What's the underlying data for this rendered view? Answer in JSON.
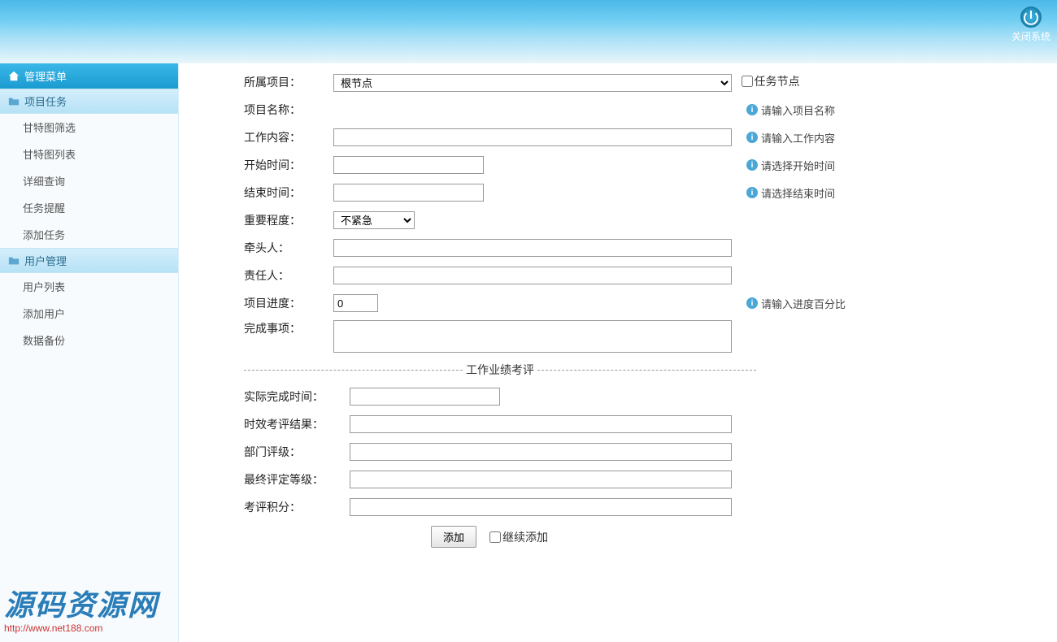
{
  "header": {
    "close_system_label": "关闭系统"
  },
  "sidebar": {
    "menu_title": "管理菜单",
    "groups": [
      {
        "name": "project_tasks",
        "label": "项目任务",
        "items": [
          {
            "name": "gantt_filter",
            "label": "甘特图筛选"
          },
          {
            "name": "gantt_list",
            "label": "甘特图列表"
          },
          {
            "name": "detail_query",
            "label": "详细查询"
          },
          {
            "name": "task_reminder",
            "label": "任务提醒"
          },
          {
            "name": "add_task",
            "label": "添加任务"
          }
        ]
      },
      {
        "name": "user_mgmt",
        "label": "用户管理",
        "items": [
          {
            "name": "user_list",
            "label": "用户列表"
          },
          {
            "name": "add_user",
            "label": "添加用户"
          },
          {
            "name": "data_backup",
            "label": "数据备份"
          }
        ]
      }
    ]
  },
  "form": {
    "project_label": "所属项目：",
    "project_value": "根节点",
    "task_node_label": "任务节点",
    "name_label": "项目名称：",
    "name_hint": "请输入项目名称",
    "content_label": "工作内容：",
    "content_hint": "请输入工作内容",
    "start_label": "开始时间：",
    "start_hint": "请选择开始时间",
    "end_label": "结束时间：",
    "end_hint": "请选择结束时间",
    "priority_label": "重要程度：",
    "priority_value": "不紧急",
    "leader_label": "牵头人：",
    "owner_label": "责任人：",
    "progress_label": "项目进度：",
    "progress_value": "0",
    "progress_hint": "请输入进度百分比",
    "done_items_label": "完成事项：",
    "section_title": "工作业绩考评",
    "actual_done_label": "实际完成时间：",
    "eff_result_label": "时效考评结果：",
    "dept_grade_label": "部门评级：",
    "final_grade_label": "最终评定等级：",
    "score_label": "考评积分：",
    "add_button": "添加",
    "continue_add_label": "继续添加"
  },
  "watermark": {
    "title": "源码资源网",
    "url": "http://www.net188.com"
  }
}
